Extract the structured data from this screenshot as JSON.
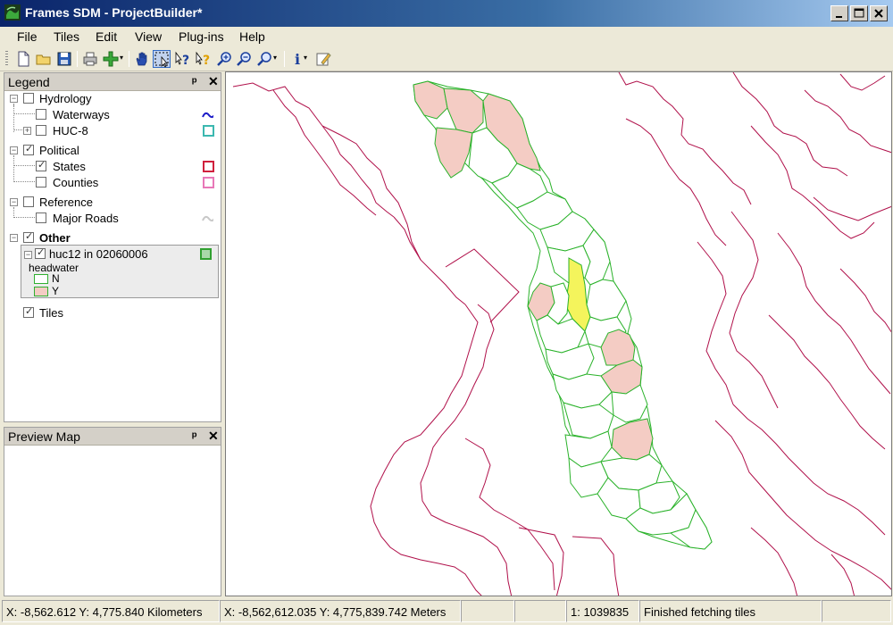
{
  "window": {
    "title": "Frames SDM  - ProjectBuilder*"
  },
  "menu": [
    "File",
    "Tiles",
    "Edit",
    "View",
    "Plug-ins",
    "Help"
  ],
  "toolbar": {
    "buttons": [
      "new-icon",
      "open-icon",
      "save-icon",
      "print-icon",
      "add-layer-icon",
      "pan-icon",
      "select-icon",
      "help-icon",
      "whats-this-icon",
      "zoom-in-icon",
      "zoom-out-icon",
      "zoom-dropdown-icon",
      "info-icon",
      "edit-icon"
    ],
    "dropdown_glyph": "▾"
  },
  "legend": {
    "title": "Legend",
    "pin": "ᵖ",
    "close": "✕",
    "groups": [
      {
        "label": "Hydrology",
        "checked": false,
        "layers": [
          {
            "label": "Waterways",
            "checked": false,
            "symbol": "wave",
            "color": "#1c1cc8"
          },
          {
            "label": "HUC-8",
            "checked": false,
            "symbol": "box",
            "color": "#3cb8b0",
            "expandable": true
          }
        ]
      },
      {
        "label": "Political",
        "checked": true,
        "layers": [
          {
            "label": "States",
            "checked": true,
            "symbol": "box",
            "color": "#d0203c"
          },
          {
            "label": "Counties",
            "checked": false,
            "symbol": "box",
            "color": "#e878b8"
          }
        ]
      },
      {
        "label": "Reference",
        "checked": false,
        "layers": [
          {
            "label": "Major Roads",
            "checked": false,
            "symbol": "wave",
            "color": "#c8c8c8"
          }
        ]
      },
      {
        "label": "Other",
        "checked": true,
        "bold": true,
        "layers": [
          {
            "label": "huc12 in 02060006",
            "checked": true,
            "symbol": "box",
            "color": "#30a030",
            "expanded": true,
            "field": "headwater",
            "classes": [
              {
                "label": "N",
                "fill": "#ffffff",
                "stroke": "#30b030"
              },
              {
                "label": "Y",
                "fill": "#f4ccc4",
                "stroke": "#30b030"
              }
            ]
          }
        ]
      }
    ],
    "tiles": {
      "label": "Tiles",
      "checked": true
    }
  },
  "preview": {
    "title": "Preview Map",
    "pin": "ᵖ",
    "close": "✕"
  },
  "map": {
    "state_color": "#b0104a",
    "huc_color": "#2ab22a",
    "headwater_fill": "#f4ccc4",
    "selected_fill": "#f4f45c"
  },
  "status": {
    "coords_km": "X: -8,562.612 Y: 4,775.840 Kilometers",
    "coords_m": "X: -8,562,612.035 Y: 4,775,839.742 Meters",
    "scale": "1: 1039835",
    "message": "Finished fetching tiles"
  }
}
